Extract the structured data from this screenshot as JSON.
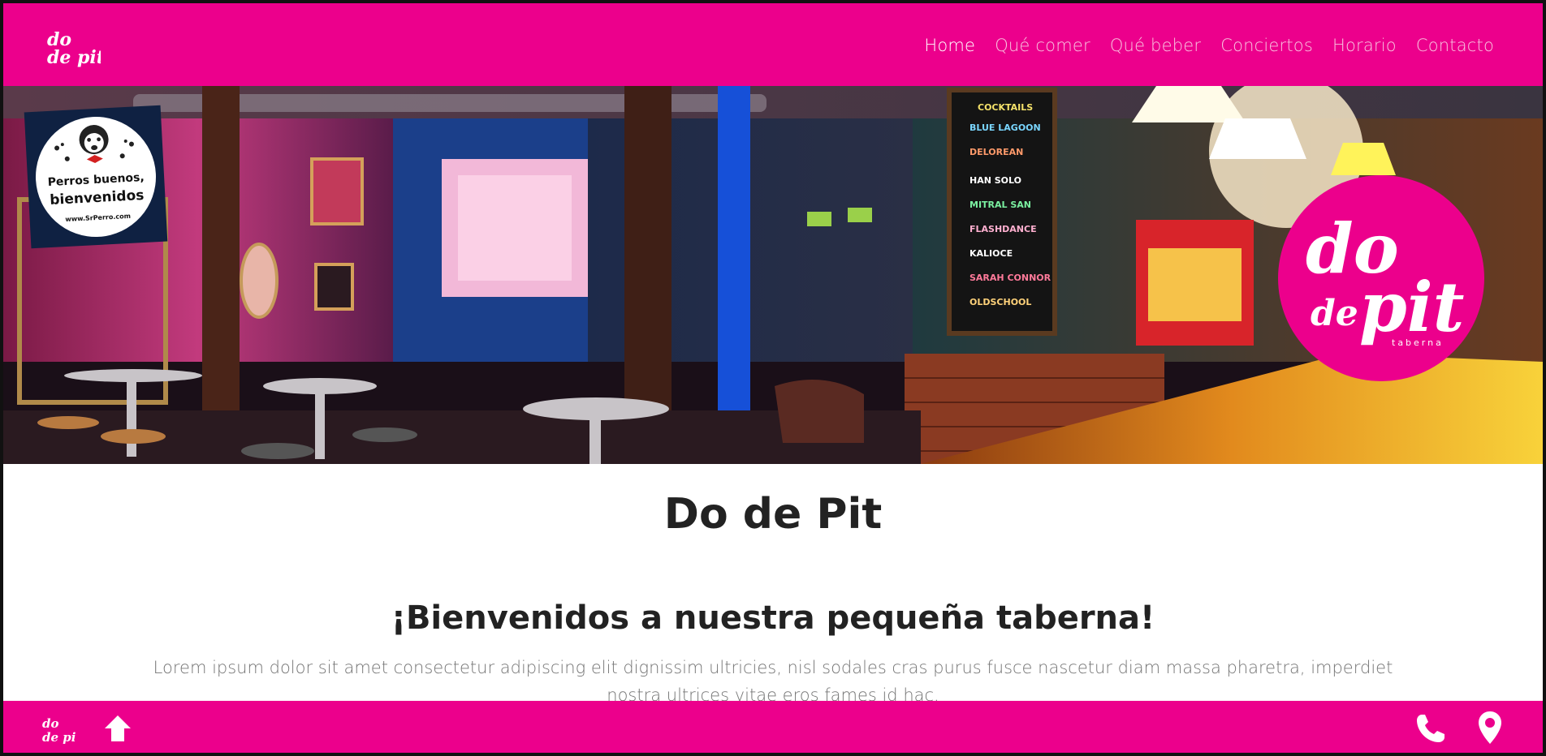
{
  "brand": {
    "logo_top": "do",
    "logo_bottom": "de pit",
    "logo_sub": "taberna",
    "primary_color": "#ec008c"
  },
  "nav": {
    "items": [
      {
        "label": "Home",
        "active": true
      },
      {
        "label": "Qué comer"
      },
      {
        "label": "Qué beber"
      },
      {
        "label": "Conciertos"
      },
      {
        "label": "Horario"
      },
      {
        "label": "Contacto"
      }
    ]
  },
  "hero": {
    "badge_line1": "Perros buenos,",
    "badge_line2": "bienvenidos",
    "badge_line3": "www.SrPerro.com",
    "big_logo_top": "do",
    "big_logo_bottom": "pit",
    "big_logo_de": "de",
    "big_logo_sub": "taberna"
  },
  "main": {
    "title": "Do de Pit",
    "subtitle": "¡Bienvenidos a nuestra pequeña taberna!",
    "lead": "Lorem ipsum dolor sit amet consectetur adipiscing elit dignissim ultricies, nisl sodales cras purus fusce nascetur diam massa pharetra, imperdiet nostra ultrices vitae eros fames id hac."
  },
  "footer": {
    "icons": [
      "arrow-up-icon",
      "phone-icon",
      "map-pin-icon"
    ]
  }
}
